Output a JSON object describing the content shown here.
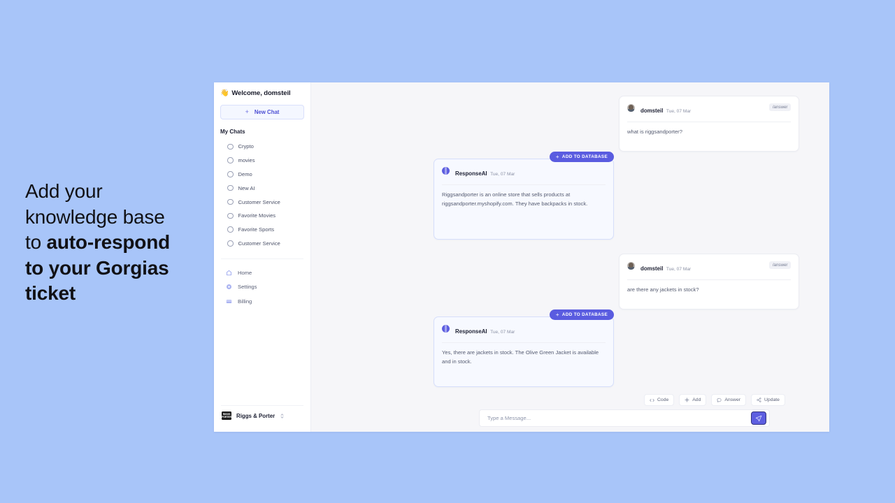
{
  "headline": {
    "line1": "Add your",
    "line2": "knowledge base",
    "line3_plain": "to ",
    "line3_bold": "auto-respond",
    "line4_bold": "to your Gorgias",
    "line5_bold": "ticket"
  },
  "sidebar": {
    "wave_icon": "waving-hand-icon",
    "welcome": "Welcome, domsteil",
    "new_chat": {
      "label": "New Chat",
      "plus": "+"
    },
    "section_title": "My Chats",
    "chats": [
      {
        "label": "Crypto"
      },
      {
        "label": "movies"
      },
      {
        "label": "Demo"
      },
      {
        "label": "New AI"
      },
      {
        "label": "Customer Service"
      },
      {
        "label": "Favorite Movies"
      },
      {
        "label": "Favorite Sports"
      },
      {
        "label": "Customer Service"
      }
    ],
    "nav": [
      {
        "label": "Home",
        "icon": "home-icon"
      },
      {
        "label": "Settings",
        "icon": "gear-icon"
      },
      {
        "label": "Billing",
        "icon": "credit-card-icon"
      }
    ],
    "org": {
      "logo_line1": "RIGGS",
      "logo_line2": "PORTER",
      "name": "Riggs & Porter",
      "chevrons": "▴▾"
    }
  },
  "messages": [
    {
      "author": "domsteil",
      "date": "Tue, 07 Mar",
      "tag": "/answer",
      "text": "what is riggsandporter?",
      "role": "user"
    },
    {
      "author": "ResponseAI",
      "date": "Tue, 07 Mar",
      "badge": "ADD TO DATABASE",
      "text": "Riggsandporter is an online store that sells products at riggsandporter.myshopify.com. They have backpacks in stock.",
      "role": "bot"
    },
    {
      "author": "domsteil",
      "date": "Tue, 07 Mar",
      "tag": "/answer",
      "text": "are there any jackets in stock?",
      "role": "user"
    },
    {
      "author": "ResponseAI",
      "date": "Tue, 07 Mar",
      "badge": "ADD TO DATABASE",
      "text": "Yes, there are jackets in stock. The Olive Green Jacket is available and in stock.",
      "role": "bot"
    }
  ],
  "toolbar": [
    {
      "label": "Code",
      "icon": "code-icon",
      "glyph": "</>"
    },
    {
      "label": "Add",
      "icon": "plus-icon",
      "glyph": "+"
    },
    {
      "label": "Answer",
      "icon": "comment-icon",
      "glyph": "○"
    },
    {
      "label": "Update",
      "icon": "share-icon",
      "glyph": "≺"
    }
  ],
  "composer": {
    "placeholder": "Type a Message...",
    "value": "",
    "send_icon": "send-paper-plane-icon"
  },
  "colors": {
    "background": "#a8c5f9",
    "accent": "#5d5ee0",
    "bot_card_bg": "#f7f9ff",
    "main_bg": "#f6f6f9"
  }
}
